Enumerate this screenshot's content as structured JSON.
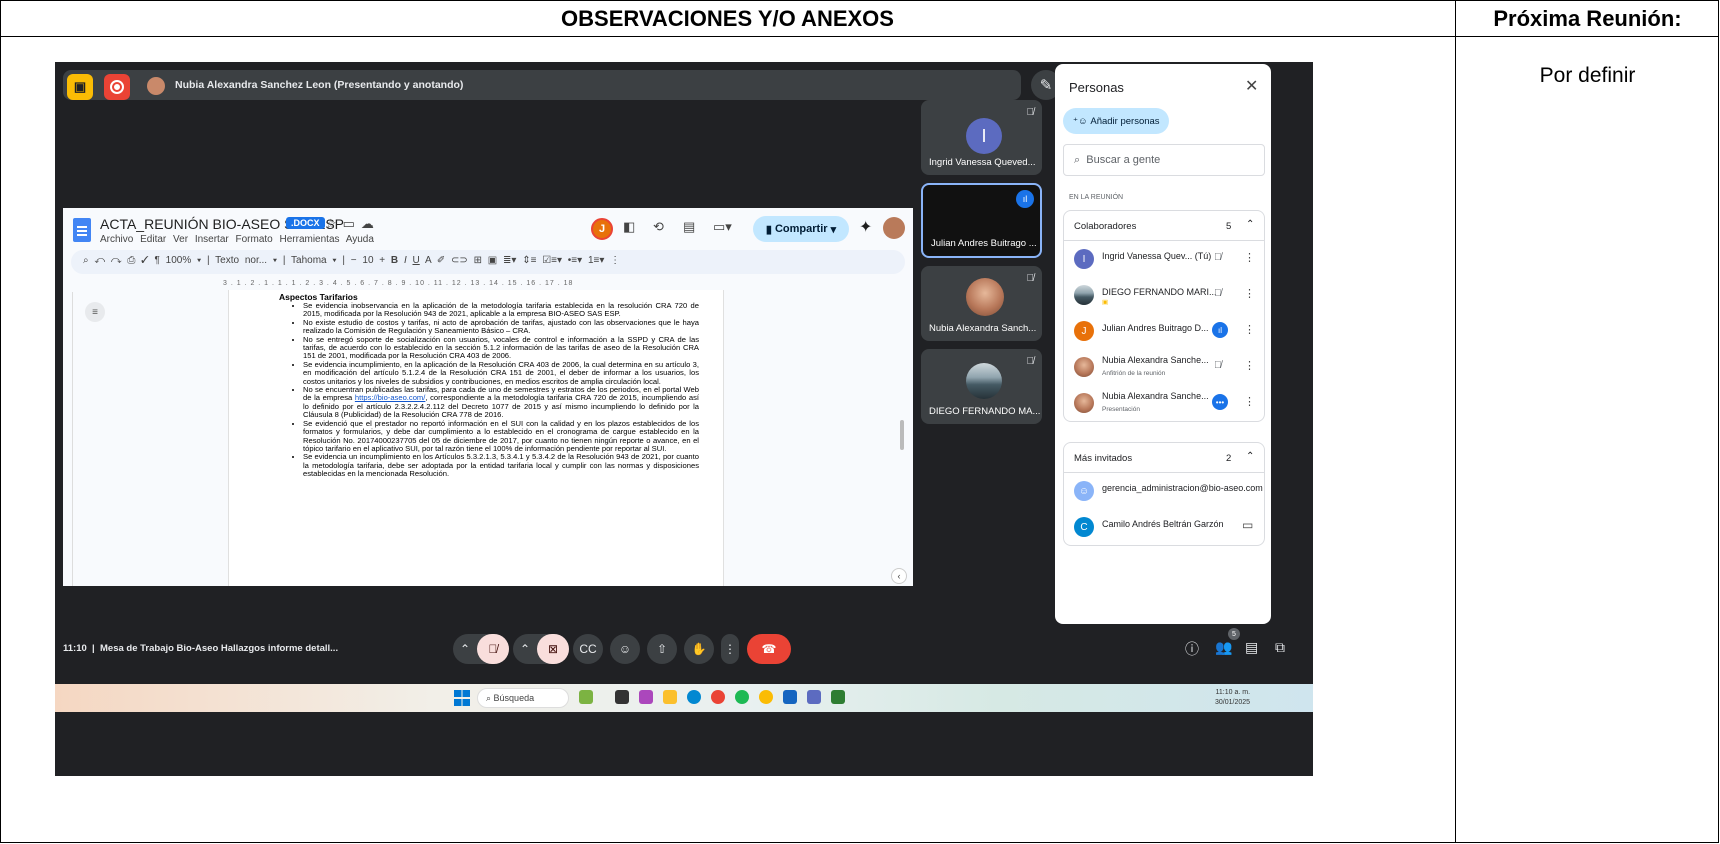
{
  "document": {
    "observations_header": "OBSERVACIONES Y/O ANEXOS",
    "next_meeting_header": "Próxima Reunión:",
    "next_meeting_value": "Por definir"
  },
  "meet": {
    "presenter_banner": "Nubia Alexandra Sanchez Leon (Presentando y anotando)",
    "meeting_time": "11:10",
    "meeting_title": "Mesa de Trabajo Bio-Aseo Hallazgos informe detall...",
    "participant_badge": "5",
    "tiles": [
      {
        "name": "Ingrid Vanessa Queved...",
        "initial": "I"
      },
      {
        "name": "Julian Andres Buitrago ..."
      },
      {
        "name": "Nubia Alexandra Sanch..."
      },
      {
        "name": "DIEGO FERNANDO MA..."
      }
    ]
  },
  "doc": {
    "title": "ACTA_REUNIÓN BIO-ASEO SAS ESP",
    "badge": ".DOCX",
    "menu": "Archivo Editar Ver Insertar Formato Herramientas Ayuda",
    "user_initial": "J",
    "share_label": "Compartir",
    "zoom": "100%",
    "style": "Texto nor...",
    "font": "Tahoma",
    "font_size": "10",
    "ruler": "3 . 1 . 2 . 1 . 1 . 1 . 2 . 3 . 4 . 5 . 6 . 7 . 8 . 9 . 10 . 11 . 12 . 13 . 14 . 15 . 16 . 17 . 18",
    "section_heading": "Aspectos Tarifarios",
    "bullets": [
      "Se evidencia inobservancia en la aplicación de la metodología tarifaria establecida en la resolución CRA 720 de 2015, modificada por la Resolución 943 de 2021, aplicable a la empresa BIO-ASEO SAS ESP.",
      "No existe estudio de costos y tarifas, ni acto de aprobación de tarifas, ajustado con las observaciones que le haya realizado la Comisión de Regulación y Saneamiento Básico – CRA.",
      "No se entregó soporte de socialización con usuarios, vocales de control e información a la SSPD y CRA de las tarifas, de acuerdo con lo establecido en la sección 5.1.2 información de las tarifas de aseo de la Resolución CRA 151 de 2001, modificada por la Resolución CRA 403 de 2006.",
      "Se evidencia incumplimiento, en la aplicación de la Resolución CRA 403 de 2006, la cual determina en su artículo 3, en modificación del artículo 5.1.2.4 de la Resolución CRA 151 de 2001, el deber de informar a los usuarios, los costos unitarios y los niveles de subsidios y contribuciones, en medios escritos de amplia circulación local.",
      "No se encuentran publicadas las tarifas, para cada de uno de semestres y estratos de los periodos, en el portal Web de la empresa",
      "Se evidenció que el prestador no reportó información en el SUI con la calidad y en los plazos establecidos de los formatos y formularios, y debe dar cumplimiento a lo establecido en el cronograma de cargue establecido en la Resolución No. 20174000237705 del 05 de diciembre de 2017, por cuanto no tienen ningún reporte o avance, en el tópico tarifario en el aplicativo SUI, por tal razón tiene el 100% de información pendiente por reportar al SUI.",
      "Se evidencia un incumplimiento en los Artículos 5.3.2.1.3, 5.3.4.1 y 5.3.4.2 de la Resolución 943 de 2021, por cuanto la metodología tarifaria, debe ser adoptada por la entidad tarifaria local y cumplir con las normas y disposiciones establecidas en la mencionada Resolución."
    ],
    "link_text": "https://bio-aseo.com/",
    "bullet5_tail": ", correspondiente a la metodología tarifaria CRA 720 de 2015, incumpliendo así lo definido por el artículo 2.3.2.2.4.2.112 del Decreto 1077 de 2015 y así mismo incumpliendo lo definido por la Cláusula 8 (Publicidad) de la Resolución CRA 778 de 2016."
  },
  "panel": {
    "title": "Personas",
    "add_label": "Añadir personas",
    "search_placeholder": "Buscar a gente",
    "section_label": "EN LA REUNIÓN",
    "collaborators": {
      "label": "Colaboradores",
      "count": "5",
      "people": [
        {
          "name": "Ingrid Vanessa Quev... (Tú)",
          "initial": "I",
          "color": "#5c6bc0"
        },
        {
          "name": "DIEGO FERNANDO MARI...",
          "color": "#455a64"
        },
        {
          "name": "Julian Andres Buitrago D...",
          "initial": "J",
          "color": "#e8710a"
        },
        {
          "name": "Nubia Alexandra Sanche...",
          "sub": "Anfitrión de la reunión",
          "color": "#b97a5a"
        },
        {
          "name": "Nubia Alexandra Sanche...",
          "sub": "Presentación",
          "color": "#b97a5a"
        }
      ]
    },
    "guests": {
      "label": "Más invitados",
      "count": "2",
      "people": [
        {
          "name": "gerencia_administracion@bio-aseo.com",
          "color": "#8ab4f8"
        },
        {
          "name": "Camilo Andrés Beltrán Garzón",
          "initial": "C",
          "color": "#0288d1"
        }
      ]
    }
  },
  "taskbar": {
    "search_label": "Búsqueda",
    "time": "11:10 a. m.",
    "date": "30/01/2025"
  },
  "colors": {
    "meet_bg": "#202124",
    "accent_blue": "#1a73e8",
    "hangup_red": "#ea4335"
  }
}
